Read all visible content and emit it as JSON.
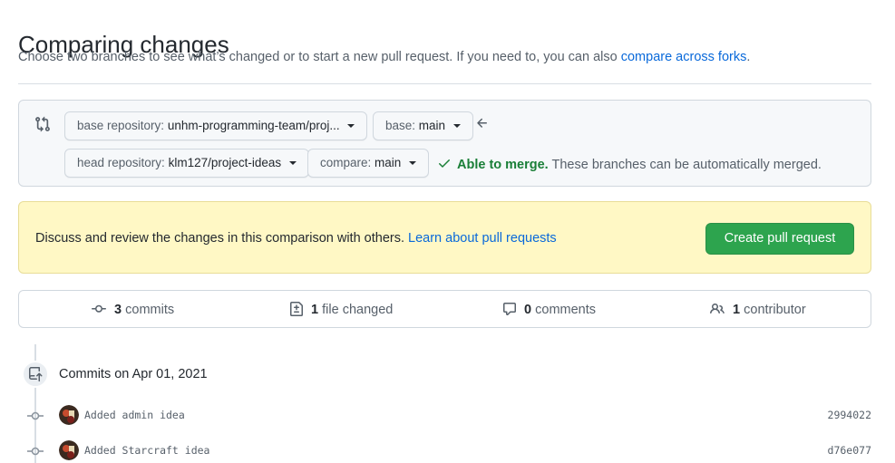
{
  "header": {
    "title": "Comparing changes",
    "subtitle": "Choose two branches to see what’s changed or to start a new pull request. If you need to, you can also",
    "subtitle_link": "compare across forks",
    "subtitle_end": "."
  },
  "range": {
    "base_repo_label": "base repository:",
    "base_repo_value": "unhm-programming-team/proj...",
    "base_label": "base:",
    "base_value": "main",
    "head_repo_label": "head repository:",
    "head_repo_value": "klm127/project-ideas",
    "compare_label": "compare:",
    "compare_value": "main",
    "merge_ok": "Able to merge.",
    "merge_text": "These branches can be automatically merged."
  },
  "flash": {
    "text": "Discuss and review the changes in this comparison with others.",
    "link": "Learn about pull requests",
    "button": "Create pull request"
  },
  "summary": {
    "commits_count": "3",
    "commits_label": "commits",
    "files_count": "1",
    "files_label": "file changed",
    "comments_count": "0",
    "comments_label": "comments",
    "contributors_count": "1",
    "contributors_label": "contributor"
  },
  "timeline": {
    "date": "Commits on Apr 01, 2021",
    "commits": [
      {
        "message": "Added admin idea",
        "sha": "2994022"
      },
      {
        "message": "Added Starcraft idea",
        "sha": "d76e077"
      }
    ]
  },
  "colors": {
    "link": "#0969da",
    "success": "#1a7f37",
    "primary_button": "#2da44e",
    "flash_bg": "#fff8c5"
  }
}
